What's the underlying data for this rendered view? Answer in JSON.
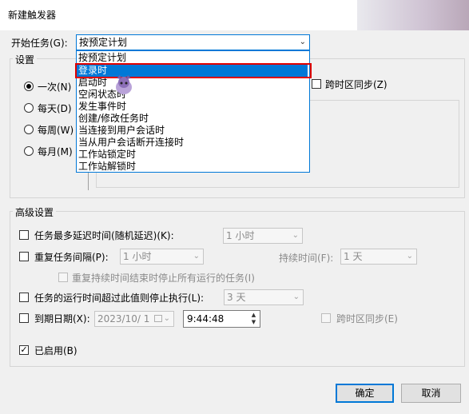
{
  "window": {
    "title": "新建触发器"
  },
  "start_task": {
    "label": "开始任务(G):",
    "value": "按预定计划",
    "options": [
      "按预定计划",
      "登录时",
      "启动时",
      "空闲状态时",
      "发生事件时",
      "创建/修改任务时",
      "当连接到用户会话时",
      "当从用户会话断开连接时",
      "工作站锁定时",
      "工作站解锁时"
    ],
    "selected_index": 1
  },
  "settings": {
    "title": "设置",
    "radios": [
      {
        "label": "一次(N)",
        "checked": true
      },
      {
        "label": "每天(D)",
        "checked": false
      },
      {
        "label": "每周(W)",
        "checked": false
      },
      {
        "label": "每月(M)",
        "checked": false
      }
    ],
    "sync_timezone": "跨时区同步(Z)"
  },
  "advanced": {
    "title": "高级设置",
    "delay_label": "任务最多延迟时间(随机延迟)(K):",
    "delay_value": "1 小时",
    "repeat_label": "重复任务间隔(P):",
    "repeat_value": "1 小时",
    "duration_label": "持续时间(F):",
    "duration_value": "1 天",
    "stop_all_label": "重复持续时间结束时停止所有运行的任务(I)",
    "stop_if_label": "任务的运行时间超过此值则停止执行(L):",
    "stop_if_value": "3 天",
    "expire_label": "到期日期(X):",
    "expire_date": "2023/10/ 1",
    "expire_time": "9:44:48",
    "expire_sync": "跨时区同步(E)",
    "enabled_label": "已启用(B)",
    "enabled_checked": true
  },
  "buttons": {
    "ok": "确定",
    "cancel": "取消"
  },
  "icons": {
    "dropdown_arrow": "⌄",
    "check": "✓",
    "calendar": "calendar-icon"
  },
  "colors": {
    "accent": "#0078d7",
    "highlight_box": "#e00000",
    "dialog_bg": "#f0f0f0"
  }
}
